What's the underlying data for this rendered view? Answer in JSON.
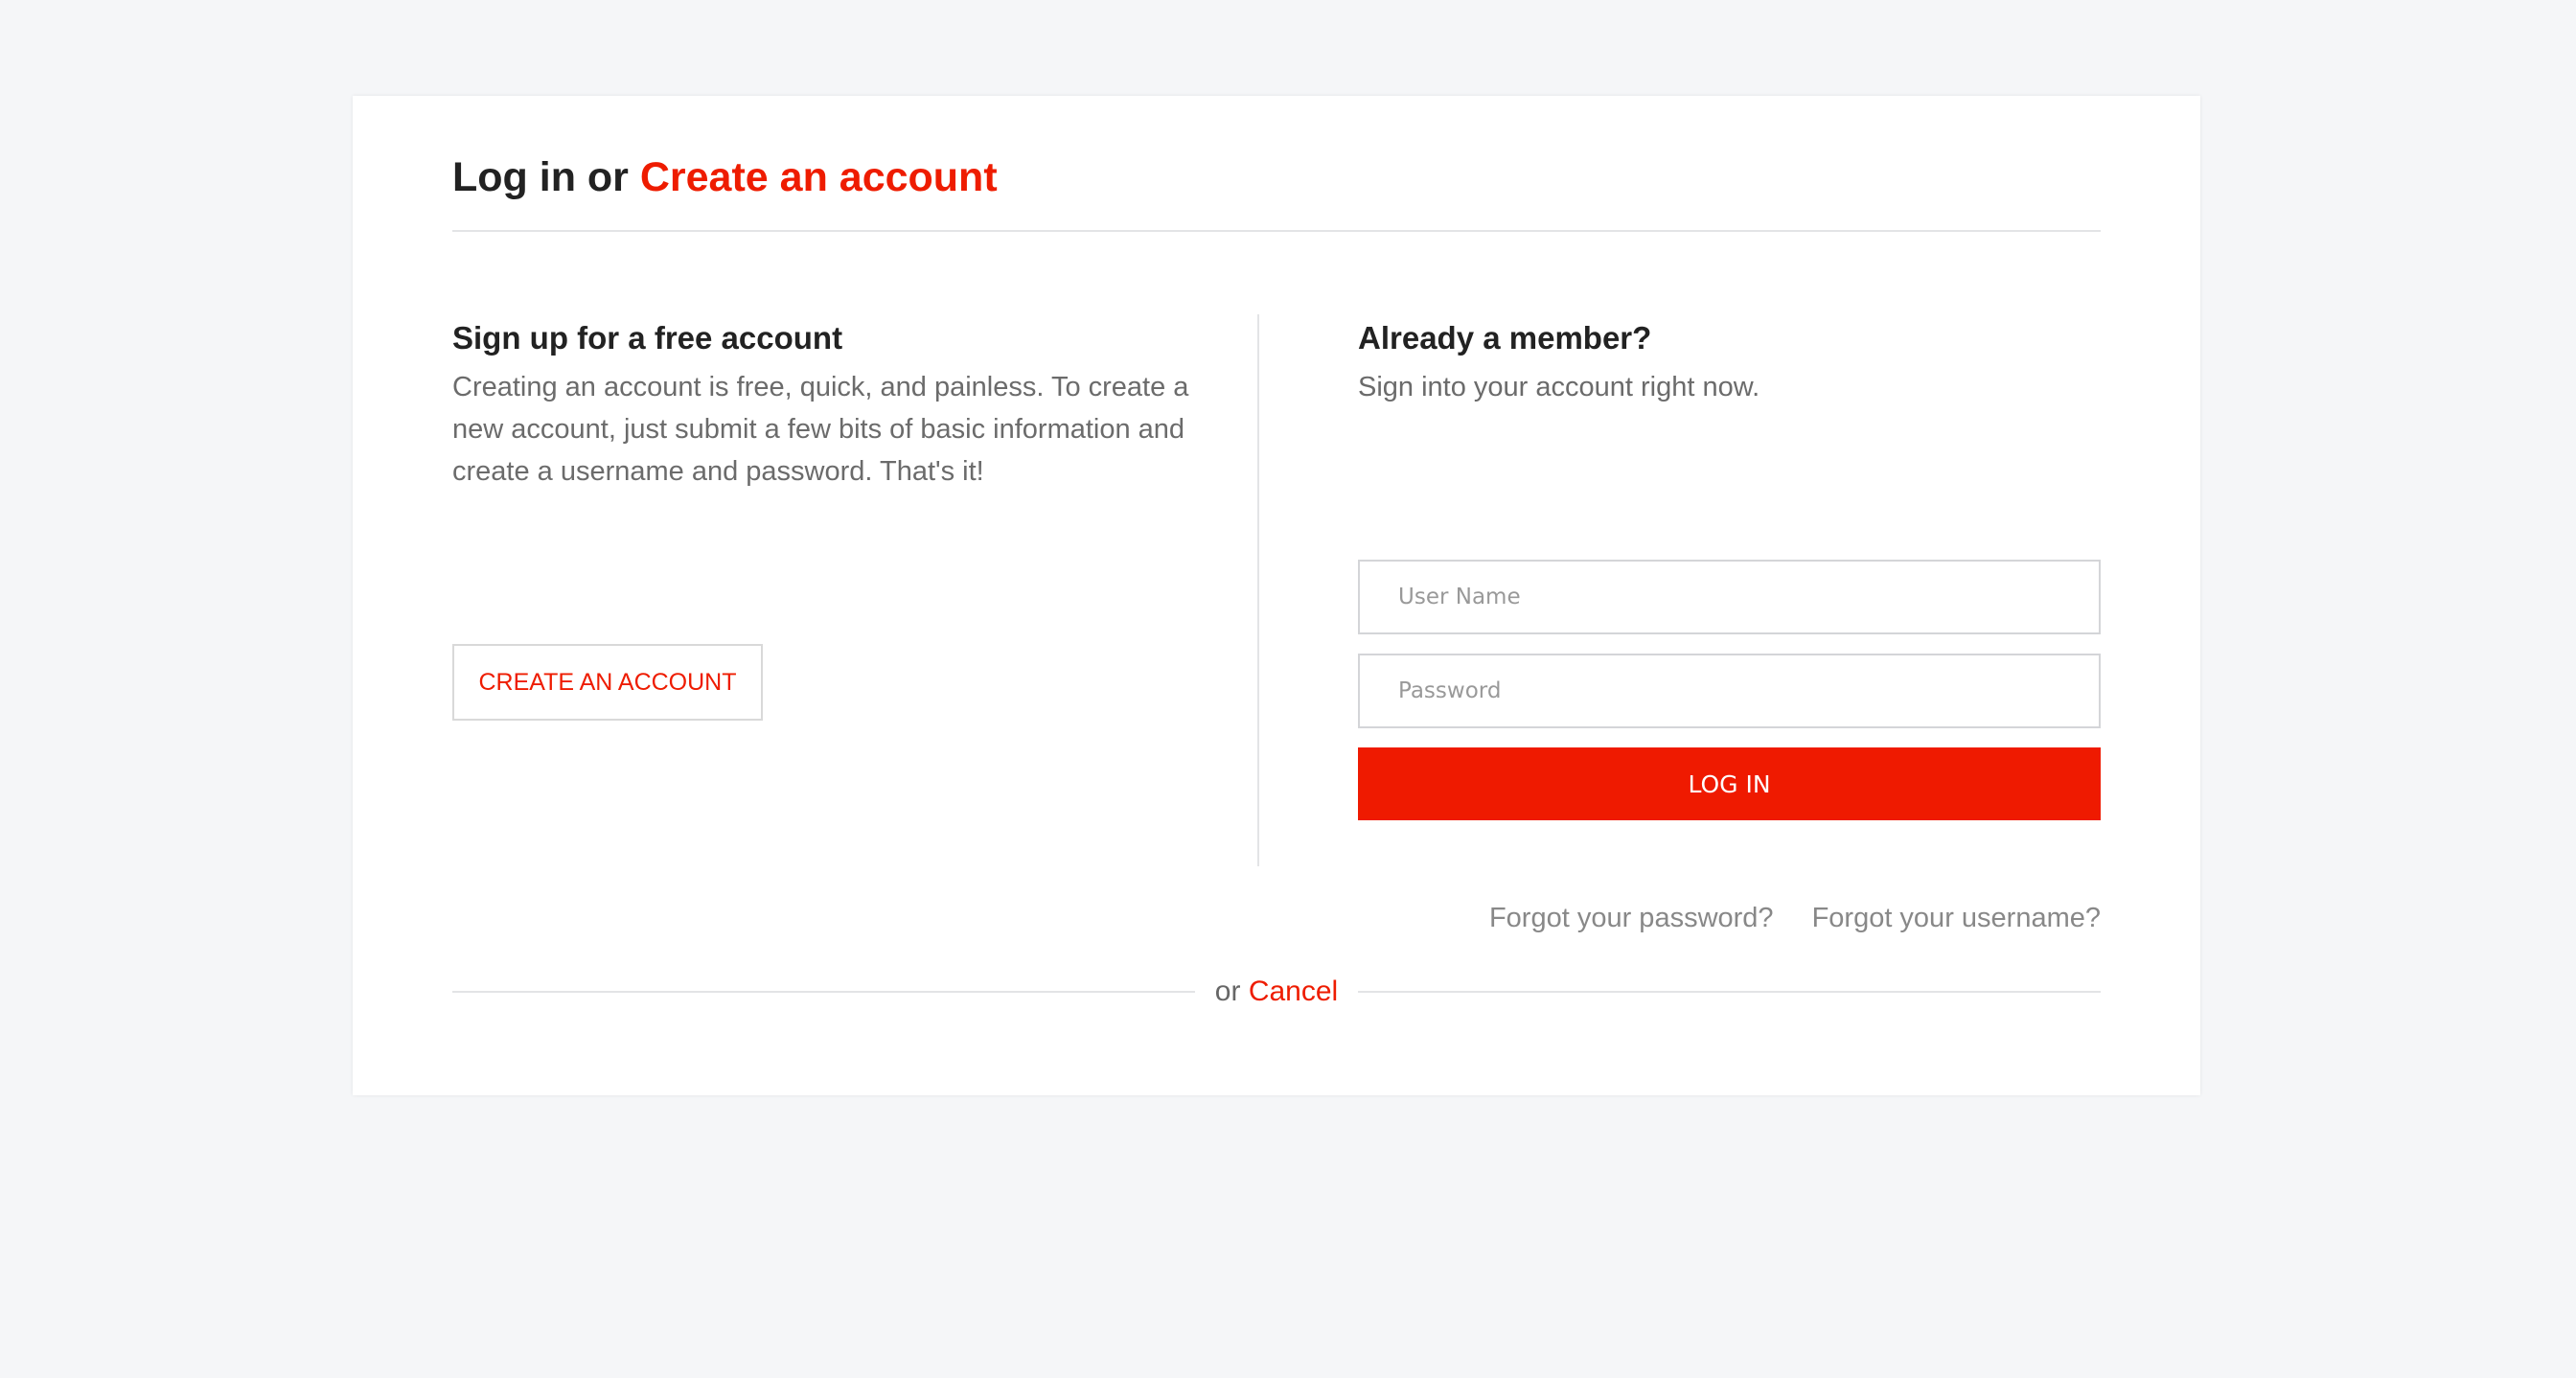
{
  "header": {
    "title_prefix": "Log in or ",
    "title_link": "Create an account"
  },
  "signup": {
    "heading": "Sign up for a free account",
    "description": "Creating an account is free, quick, and painless. To create a new account, just submit a few bits of basic information and create a username and password. That's it!",
    "button_label": "CREATE AN ACCOUNT"
  },
  "login": {
    "heading": "Already a member?",
    "subtext": "Sign into your account right now.",
    "username_placeholder": "User Name",
    "password_placeholder": "Password",
    "button_label": "LOG IN",
    "forgot_password": "Forgot your password?",
    "forgot_username": "Forgot your username?"
  },
  "footer": {
    "or_text": "or",
    "cancel_label": "Cancel"
  },
  "colors": {
    "accent": "#ee1c00",
    "background": "#f5f6f8"
  }
}
